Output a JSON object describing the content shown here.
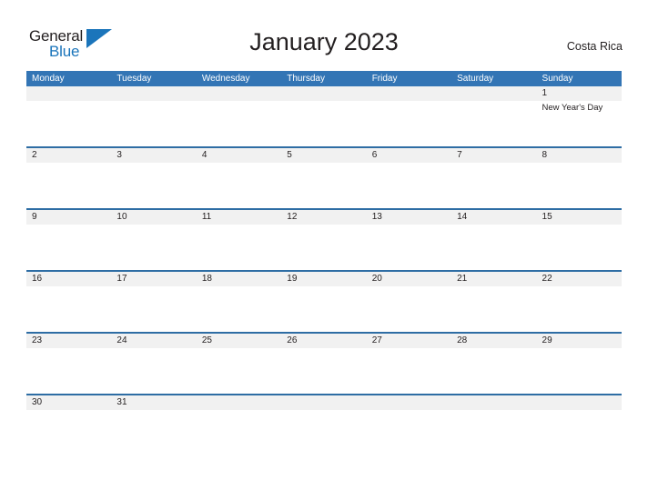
{
  "branding": {
    "logo_word_1": "General",
    "logo_word_2": "Blue",
    "logo_flag_icon": "flag-triangle-icon",
    "logo_color_dark": "#231f20",
    "logo_color_blue": "#1b75bb"
  },
  "header": {
    "title": "January 2023",
    "country": "Costa Rica"
  },
  "theme": {
    "header_blue": "#3375b5",
    "separator_blue": "#2e6da4",
    "date_band_gray": "#f1f1f1",
    "text_dark": "#231f20",
    "page_background": "#ffffff"
  },
  "calendar": {
    "month": "January",
    "year": "2023",
    "weekday_headers": [
      "Monday",
      "Tuesday",
      "Wednesday",
      "Thursday",
      "Friday",
      "Saturday",
      "Sunday"
    ],
    "weeks": [
      {
        "days": [
          {
            "date": "",
            "events": []
          },
          {
            "date": "",
            "events": []
          },
          {
            "date": "",
            "events": []
          },
          {
            "date": "",
            "events": []
          },
          {
            "date": "",
            "events": []
          },
          {
            "date": "",
            "events": []
          },
          {
            "date": "1",
            "events": [
              "New Year's Day"
            ]
          }
        ]
      },
      {
        "days": [
          {
            "date": "2",
            "events": []
          },
          {
            "date": "3",
            "events": []
          },
          {
            "date": "4",
            "events": []
          },
          {
            "date": "5",
            "events": []
          },
          {
            "date": "6",
            "events": []
          },
          {
            "date": "7",
            "events": []
          },
          {
            "date": "8",
            "events": []
          }
        ]
      },
      {
        "days": [
          {
            "date": "9",
            "events": []
          },
          {
            "date": "10",
            "events": []
          },
          {
            "date": "11",
            "events": []
          },
          {
            "date": "12",
            "events": []
          },
          {
            "date": "13",
            "events": []
          },
          {
            "date": "14",
            "events": []
          },
          {
            "date": "15",
            "events": []
          }
        ]
      },
      {
        "days": [
          {
            "date": "16",
            "events": []
          },
          {
            "date": "17",
            "events": []
          },
          {
            "date": "18",
            "events": []
          },
          {
            "date": "19",
            "events": []
          },
          {
            "date": "20",
            "events": []
          },
          {
            "date": "21",
            "events": []
          },
          {
            "date": "22",
            "events": []
          }
        ]
      },
      {
        "days": [
          {
            "date": "23",
            "events": []
          },
          {
            "date": "24",
            "events": []
          },
          {
            "date": "25",
            "events": []
          },
          {
            "date": "26",
            "events": []
          },
          {
            "date": "27",
            "events": []
          },
          {
            "date": "28",
            "events": []
          },
          {
            "date": "29",
            "events": []
          }
        ]
      },
      {
        "days": [
          {
            "date": "30",
            "events": []
          },
          {
            "date": "31",
            "events": []
          },
          {
            "date": "",
            "events": []
          },
          {
            "date": "",
            "events": []
          },
          {
            "date": "",
            "events": []
          },
          {
            "date": "",
            "events": []
          },
          {
            "date": "",
            "events": []
          }
        ]
      }
    ]
  }
}
